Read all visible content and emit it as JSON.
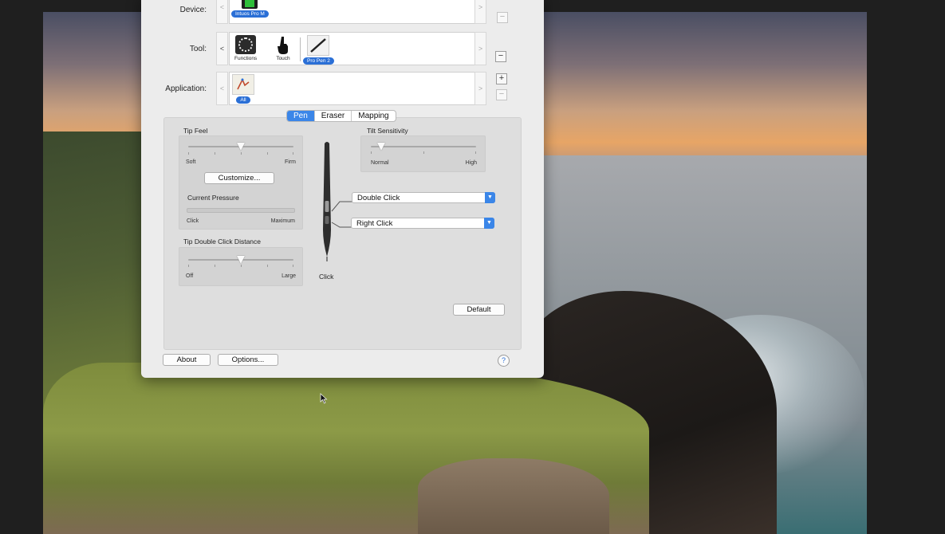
{
  "window": {
    "device_label": "Device:",
    "tool_label": "Tool:",
    "application_label": "Application:",
    "device_badge": "Intuos Pro M",
    "tools": [
      {
        "caption": "Functions"
      },
      {
        "caption": "Touch"
      }
    ],
    "selected_tool_badge": "Pro Pen 2",
    "application_badge": "All",
    "nav_prev": "<",
    "nav_next": ">",
    "plus": "+",
    "minus": "−"
  },
  "tabs": [
    {
      "label": "Pen",
      "active": true
    },
    {
      "label": "Eraser",
      "active": false
    },
    {
      "label": "Mapping",
      "active": false
    }
  ],
  "pen_panel": {
    "tip_feel": {
      "title": "Tip Feel",
      "min_label": "Soft",
      "max_label": "Firm",
      "value_fraction": 0.5,
      "customize_label": "Customize..."
    },
    "current_pressure": {
      "title": "Current Pressure",
      "min_label": "Click",
      "max_label": "Maximum",
      "value_fraction": 0.0
    },
    "tip_double_click": {
      "title": "Tip Double Click Distance",
      "min_label": "Off",
      "max_label": "Large",
      "value_fraction": 0.5
    },
    "tilt_sensitivity": {
      "title": "Tilt Sensitivity",
      "min_label": "Normal",
      "max_label": "High",
      "value_fraction": 0.1
    },
    "upper_button": "Double Click",
    "lower_button": "Right Click",
    "tip_label": "Click",
    "default_label": "Default"
  },
  "footer": {
    "about_label": "About",
    "options_label": "Options...",
    "help_label": "?"
  },
  "colors": {
    "accent": "#3b86e8",
    "badge": "#2a6fd6",
    "dialog_bg": "#ececec"
  }
}
